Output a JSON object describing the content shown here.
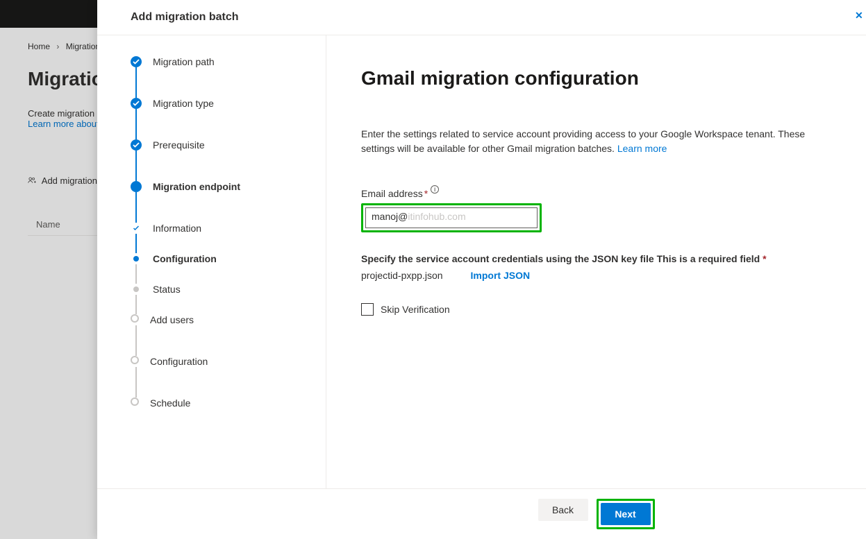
{
  "bg": {
    "breadcrumb": {
      "home": "Home",
      "sep": "›",
      "current": "Migration"
    },
    "heading": "Migration",
    "desc": "Create migration",
    "link": "Learn more about",
    "action": "Add migration",
    "table_col": "Name"
  },
  "panel": {
    "title": "Add migration batch"
  },
  "steps": [
    {
      "label": "Migration path",
      "state": "done",
      "type": "main"
    },
    {
      "label": "Migration type",
      "state": "done",
      "type": "main"
    },
    {
      "label": "Prerequisite",
      "state": "done",
      "type": "main"
    },
    {
      "label": "Migration endpoint",
      "state": "current",
      "type": "main",
      "bold": true
    },
    {
      "label": "Information",
      "state": "sub-done",
      "type": "sub"
    },
    {
      "label": "Configuration",
      "state": "sub-current",
      "type": "sub",
      "bold": true
    },
    {
      "label": "Status",
      "state": "sub-future",
      "type": "sub"
    },
    {
      "label": "Add users",
      "state": "future",
      "type": "main"
    },
    {
      "label": "Configuration",
      "state": "future",
      "type": "main"
    },
    {
      "label": "Schedule",
      "state": "future",
      "type": "main"
    }
  ],
  "content": {
    "title": "Gmail migration configuration",
    "desc": "Enter the settings related to service account providing access to your Google Workspace tenant. These settings will be available for other Gmail migration batches. ",
    "learn_more": "Learn more",
    "email_label": "Email address",
    "email_value": "manoj@",
    "email_masked": "itinfohub.com",
    "cred_label": "Specify the service account credentials using the JSON key file This is a required field",
    "json_file": "projectid-pxpp.json",
    "import_json": "Import JSON",
    "skip_verification": "Skip Verification"
  },
  "footer": {
    "back": "Back",
    "next": "Next"
  }
}
